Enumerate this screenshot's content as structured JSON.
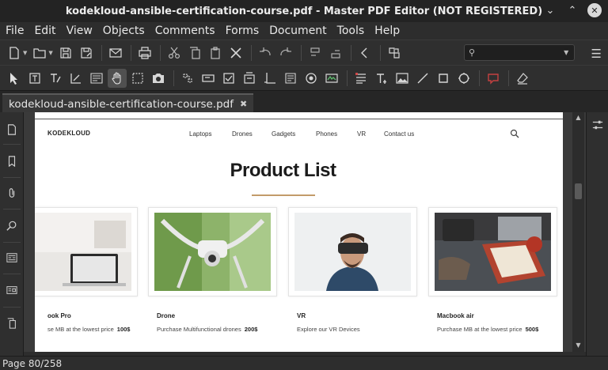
{
  "window": {
    "title": "kodekloud-ansible-certification-course.pdf - Master PDF Editor (NOT REGISTERED)"
  },
  "menubar": {
    "items": [
      "File",
      "Edit",
      "View",
      "Objects",
      "Comments",
      "Forms",
      "Document",
      "Tools",
      "Help"
    ]
  },
  "toolbar1": {
    "search_placeholder": "",
    "icons": [
      "new-document",
      "open-folder",
      "save",
      "save-as",
      "email",
      "print",
      "cut",
      "copy",
      "paste",
      "delete",
      "undo",
      "redo",
      "first-page",
      "last-page",
      "previous-page",
      "rotate",
      "search",
      "menu"
    ]
  },
  "toolbar2": {
    "icons": [
      "select-arrow",
      "text-select",
      "edit-text",
      "edit-object",
      "forms",
      "hand-tool",
      "marquee-select",
      "snapshot",
      "link",
      "text-field",
      "checkbox",
      "radio-button",
      "combo-box",
      "list-box",
      "signature",
      "add-text",
      "image",
      "line",
      "rectangle",
      "ellipse",
      "highlight",
      "eraser"
    ]
  },
  "tab": {
    "title": "kodekloud-ansible-certification-course.pdf"
  },
  "document": {
    "brand": "KODEKLOUD",
    "nav": [
      "Laptops",
      "Drones",
      "Gadgets",
      "Phones",
      "VR",
      "Contact us"
    ],
    "heading": "Product List",
    "products": [
      {
        "name": "ook Pro",
        "desc": "se MB at the lowest price",
        "price": "100$"
      },
      {
        "name": "Drone",
        "desc": "Purchase Multifunctional drones",
        "price": "200$"
      },
      {
        "name": "VR",
        "desc": "Explore our VR Devices",
        "price": ""
      },
      {
        "name": "Macbook air",
        "desc": "Purchase MB at the lowest price",
        "price": "500$"
      }
    ]
  },
  "status": {
    "page_info": "Page 80/258"
  },
  "colors": {
    "accent_underline": "#c39b6a",
    "app_bg": "#2d2d2d",
    "page_bg": "#ffffff"
  }
}
